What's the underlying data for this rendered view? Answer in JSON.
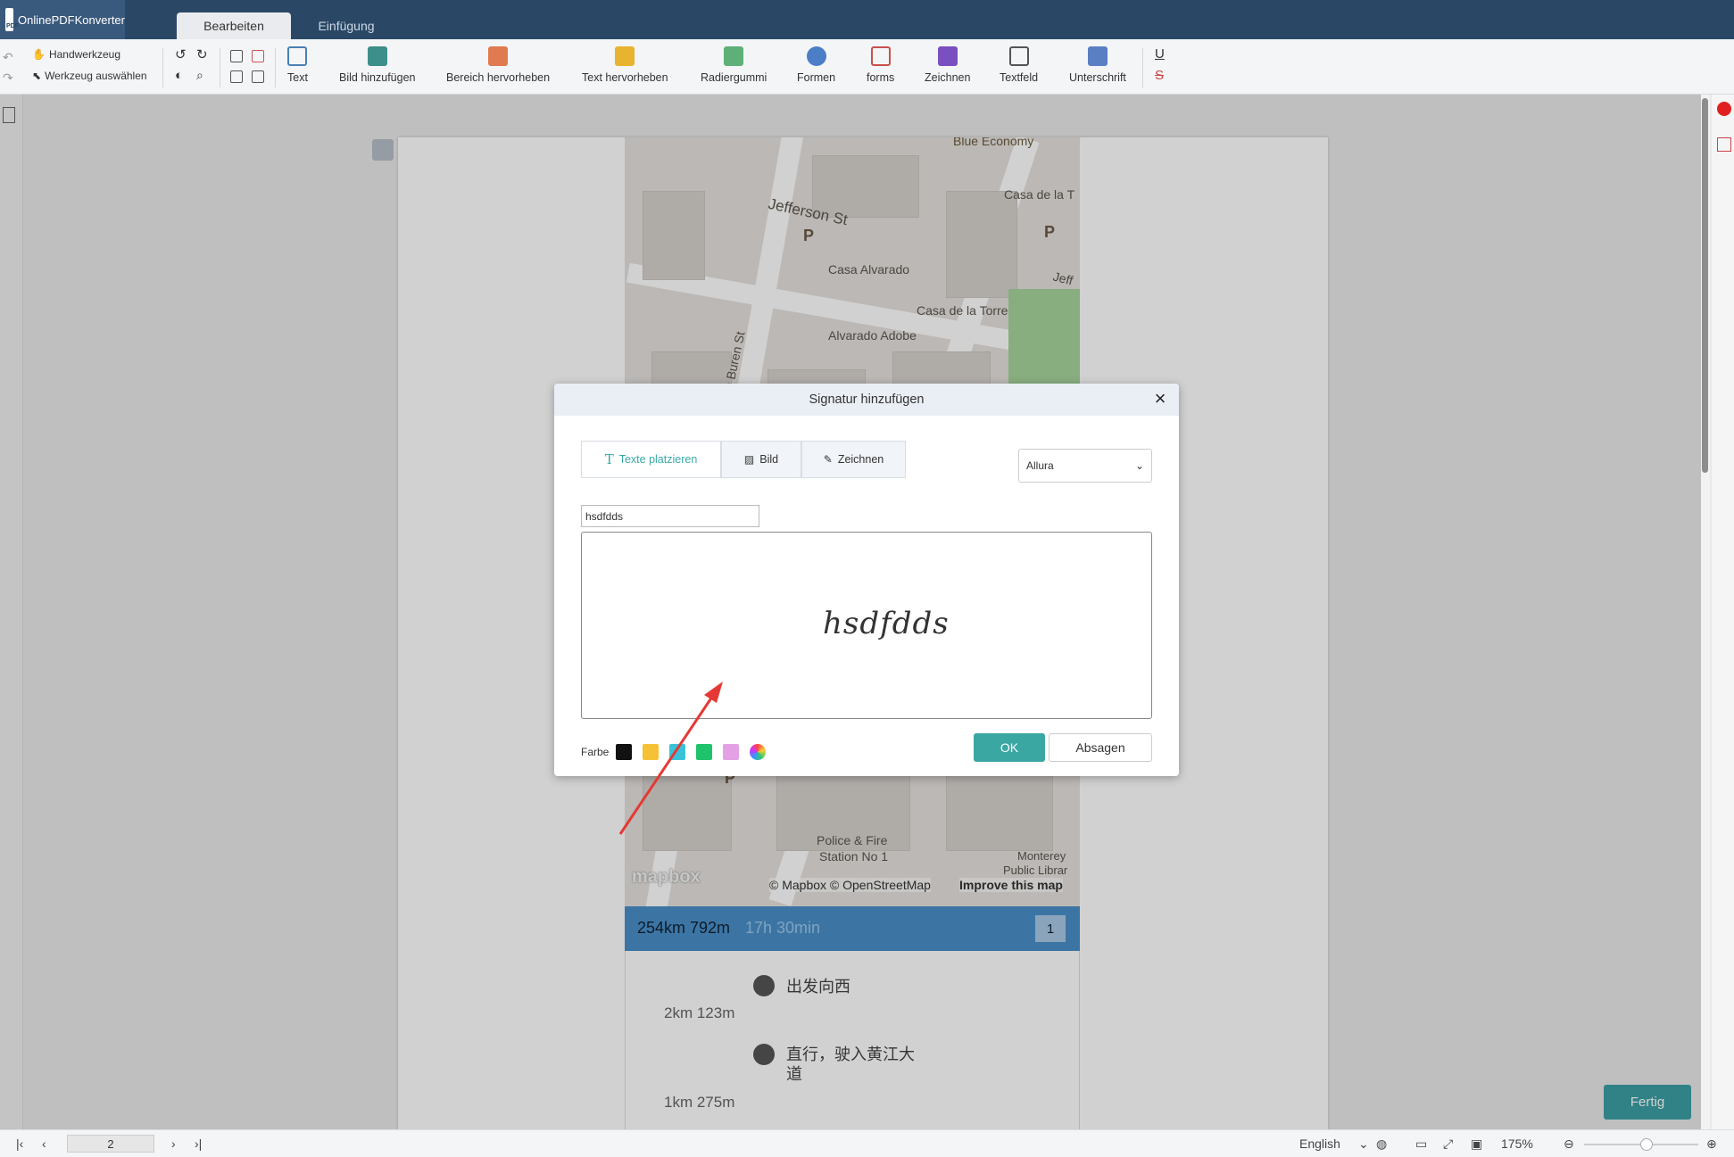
{
  "app": {
    "logo_text": "OnlinePDFKonverter"
  },
  "tabs": [
    {
      "label": "Bearbeiten"
    },
    {
      "label": "Einfügung"
    }
  ],
  "toolbar": {
    "hand_tool": "Handwerkzeug",
    "select_tool": "Werkzeug auswählen",
    "tools": [
      {
        "label": "Text"
      },
      {
        "label": "Bild hinzufügen"
      },
      {
        "label": "Bereich hervorheben"
      },
      {
        "label": "Text hervorheben"
      },
      {
        "label": "Radiergummi"
      },
      {
        "label": "Formen"
      },
      {
        "label": "forms"
      },
      {
        "label": "Zeichnen"
      },
      {
        "label": "Textfeld"
      },
      {
        "label": "Unterschrift"
      }
    ]
  },
  "map": {
    "labels": [
      "Blue Economy",
      "Jefferson St",
      "Casa de la T",
      "Casa Alvarado",
      "Casa de la Torre",
      "Alvarado Adobe",
      "Van Buren St",
      "Jeff",
      "Police & Fire",
      "Station No 1",
      "Monterey",
      "Public Librar"
    ],
    "attribution": "© Mapbox © OpenStreetMap",
    "improve": "Improve this map",
    "brand": "mapbox"
  },
  "route": {
    "distance": "254km 792m",
    "duration": "17h 30min",
    "page_badge": "1",
    "steps": [
      {
        "text": "出发向西",
        "dist": "2km 123m"
      },
      {
        "text": "直行，驶入黄江大",
        "text2": "道",
        "dist": "1km 275m"
      }
    ]
  },
  "modal": {
    "title": "Signatur hinzufügen",
    "tab_text": "Texte platzieren",
    "tab_image": "Bild",
    "tab_draw": "Zeichnen",
    "font": "Allura",
    "name_value": "hsdfdds",
    "signature_preview": "hsdfdds",
    "color_label": "Farbe",
    "colors": [
      "#111111",
      "#f6c136",
      "#39c3d8",
      "#1fc36b",
      "#e4a1e6"
    ],
    "ok": "OK",
    "cancel": "Absagen"
  },
  "fertig": "Fertig",
  "status": {
    "page_number": "2",
    "language": "English",
    "zoom": "175%"
  }
}
